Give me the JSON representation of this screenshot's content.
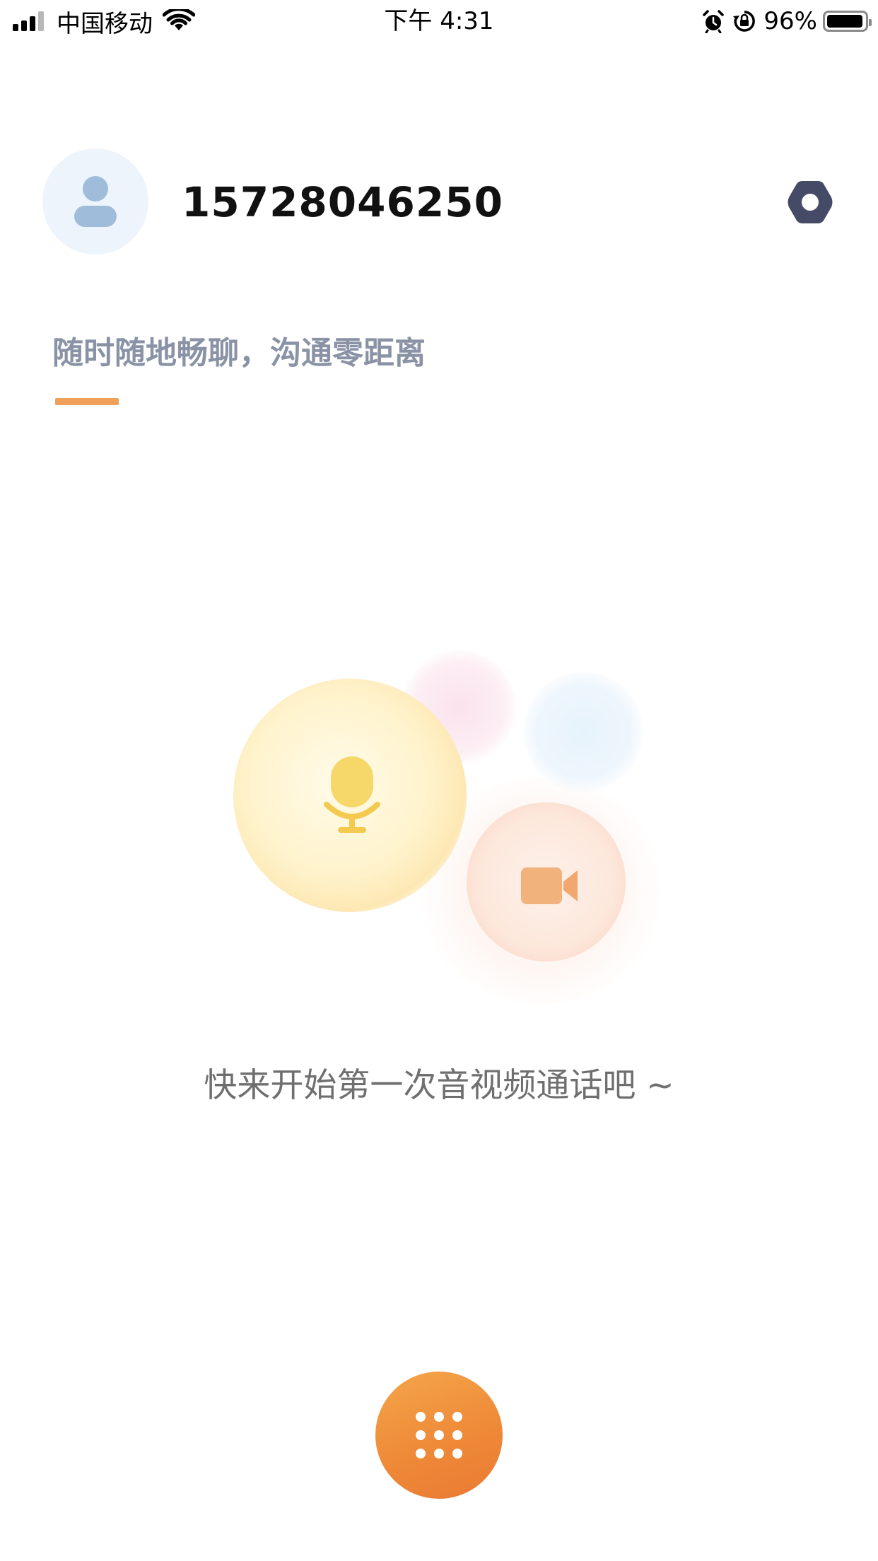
{
  "status_bar": {
    "carrier": "中国移动",
    "time": "下午 4:31",
    "battery_percent": "96%",
    "battery_level": 0.96,
    "icons": [
      "signal-icon",
      "wifi-icon",
      "alarm-icon",
      "orientation-lock-icon",
      "battery-icon"
    ]
  },
  "profile": {
    "phone_number": "15728046250",
    "avatar_icon": "person-icon",
    "settings_icon": "settings-icon"
  },
  "tagline": {
    "text": "随时随地畅聊，沟通零距离"
  },
  "empty_state": {
    "message": "快来开始第一次音视频通话吧 ~",
    "icons": [
      "microphone-icon",
      "video-camera-icon"
    ]
  },
  "dialpad": {
    "icon": "dialpad-icon"
  },
  "colors": {
    "accent": "#ef8a3a",
    "tagline_text": "#8a93a6",
    "underline": "#f0a05a",
    "settings_icon": "#454a66",
    "avatar_bg": "#eef4fb",
    "avatar_icon": "#9fbcdb",
    "mic": "#f6d76a",
    "video": "#f2b27c"
  }
}
